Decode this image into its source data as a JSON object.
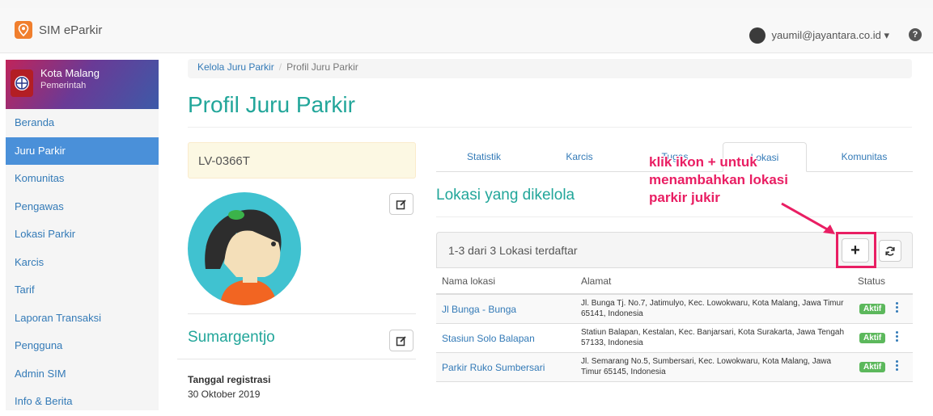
{
  "app": {
    "title": "SIM eParkir",
    "user_email": "yaumil@jayantara.co.id ▾",
    "help": "?"
  },
  "sidebar": {
    "org_name": "Kota Malang",
    "org_sub": "Pemerintah",
    "items": [
      {
        "label": "Beranda"
      },
      {
        "label": "Juru Parkir"
      },
      {
        "label": "Komunitas"
      },
      {
        "label": "Pengawas"
      },
      {
        "label": "Lokasi Parkir"
      },
      {
        "label": "Karcis"
      },
      {
        "label": "Tarif"
      },
      {
        "label": "Laporan Transaksi"
      },
      {
        "label": "Pengguna"
      },
      {
        "label": "Admin SIM"
      },
      {
        "label": "Info & Berita"
      }
    ],
    "active_index": 1
  },
  "breadcrumb": {
    "parent": "Kelola Juru Parkir",
    "separator": "/",
    "current": "Profil Juru Parkir"
  },
  "page": {
    "title": "Profil Juru Parkir"
  },
  "profile": {
    "code": "LV-0366T",
    "name": "Sumargentjo",
    "reg_label": "Tanggal registrasi",
    "reg_date": "30 Oktober 2019"
  },
  "tabs": [
    {
      "label": "Statistik"
    },
    {
      "label": "Karcis"
    },
    {
      "label": "Tugas"
    },
    {
      "label": "Lokasi"
    },
    {
      "label": "Komunitas"
    }
  ],
  "locations": {
    "section_title": "Lokasi yang dikelola",
    "count_text": "1-3 dari 3 Lokasi terdaftar",
    "add_label": "+",
    "columns": {
      "name": "Nama lokasi",
      "address": "Alamat",
      "status": "Status"
    },
    "rows": [
      {
        "name": "Jl Bunga - Bunga",
        "address": "Jl. Bunga Tj. No.7, Jatimulyo, Kec. Lowokwaru, Kota Malang, Jawa Timur 65141, Indonesia",
        "status": "Aktif"
      },
      {
        "name": "Stasiun Solo Balapan",
        "address": "Statiun Balapan, Kestalan, Kec. Banjarsari, Kota Surakarta, Jawa Tengah 57133, Indonesia",
        "status": "Aktif"
      },
      {
        "name": "Parkir Ruko Sumbersari",
        "address": "Jl. Semarang No.5, Sumbersari, Kec. Lowokwaru, Kota Malang, Jawa Timur 65145, Indonesia",
        "status": "Aktif"
      }
    ]
  },
  "annotation": {
    "line1": "klik ikon + untuk",
    "line2": "menambahkan lokasi",
    "line3": "parkir jukir"
  },
  "colors": {
    "accent": "#22a69a",
    "link": "#337ab7",
    "active_nav": "#4a90d9",
    "badge": "#5cb85c",
    "annotation": "#e91e63"
  }
}
